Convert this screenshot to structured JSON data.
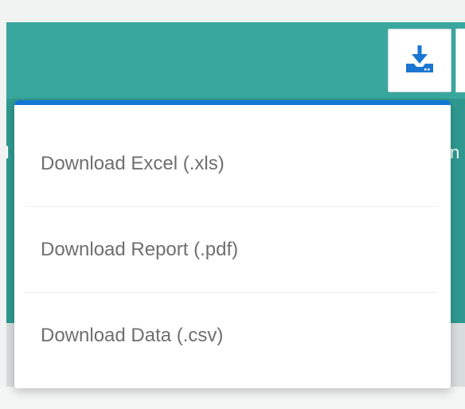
{
  "toolbar": {
    "download_icon": "download-tray-icon",
    "accent_color": "#3aa79e",
    "icon_color": "#1a76d2"
  },
  "background": {
    "left_edge_char": "I",
    "right_edge_char": "n"
  },
  "menu": {
    "accent_color": "#1377d6",
    "items": [
      {
        "label": "Download Excel (.xls)"
      },
      {
        "label": "Download Report (.pdf)"
      },
      {
        "label": "Download Data (.csv)"
      }
    ]
  }
}
